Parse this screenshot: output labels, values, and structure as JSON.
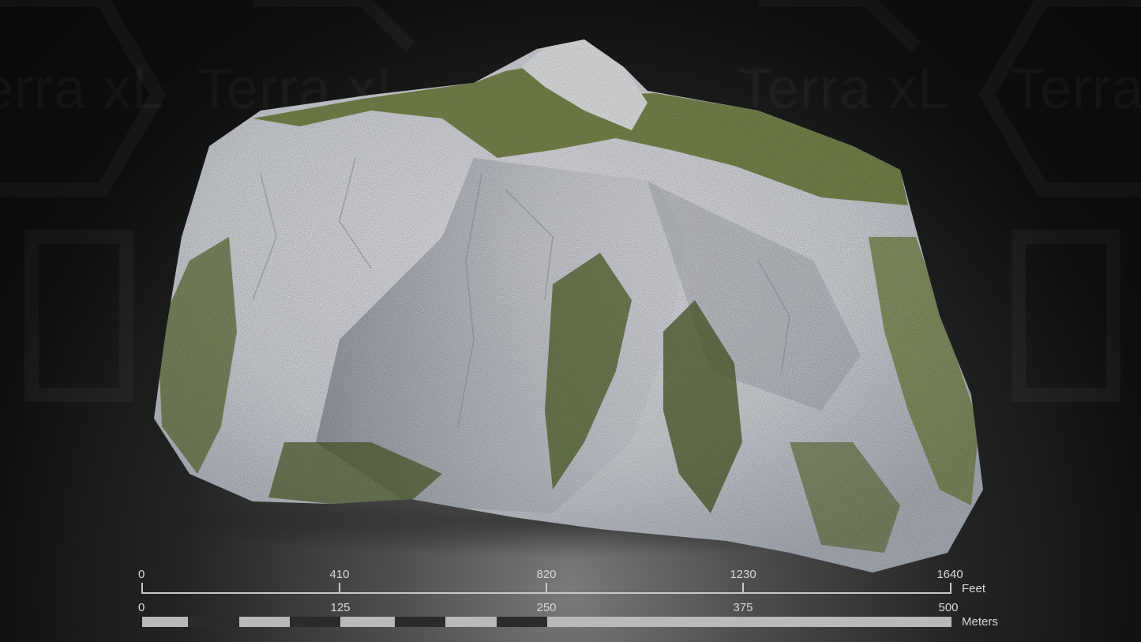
{
  "watermark": {
    "text": "Terra xL"
  },
  "scale_bar": {
    "feet": {
      "ticks": [
        "0",
        "410",
        "820",
        "1230",
        "1640"
      ],
      "unit": "Feet"
    },
    "meters": {
      "ticks": [
        "0",
        "125",
        "250",
        "375",
        "500"
      ],
      "unit": "Meters"
    }
  },
  "colors": {
    "rock": "#e4e7ec",
    "rock_shadow": "#a4aab4",
    "vegetation": "#6d7f36",
    "vegetation_dark": "#3f4a22",
    "background": "#111111",
    "scale": "#c8c8c8"
  }
}
